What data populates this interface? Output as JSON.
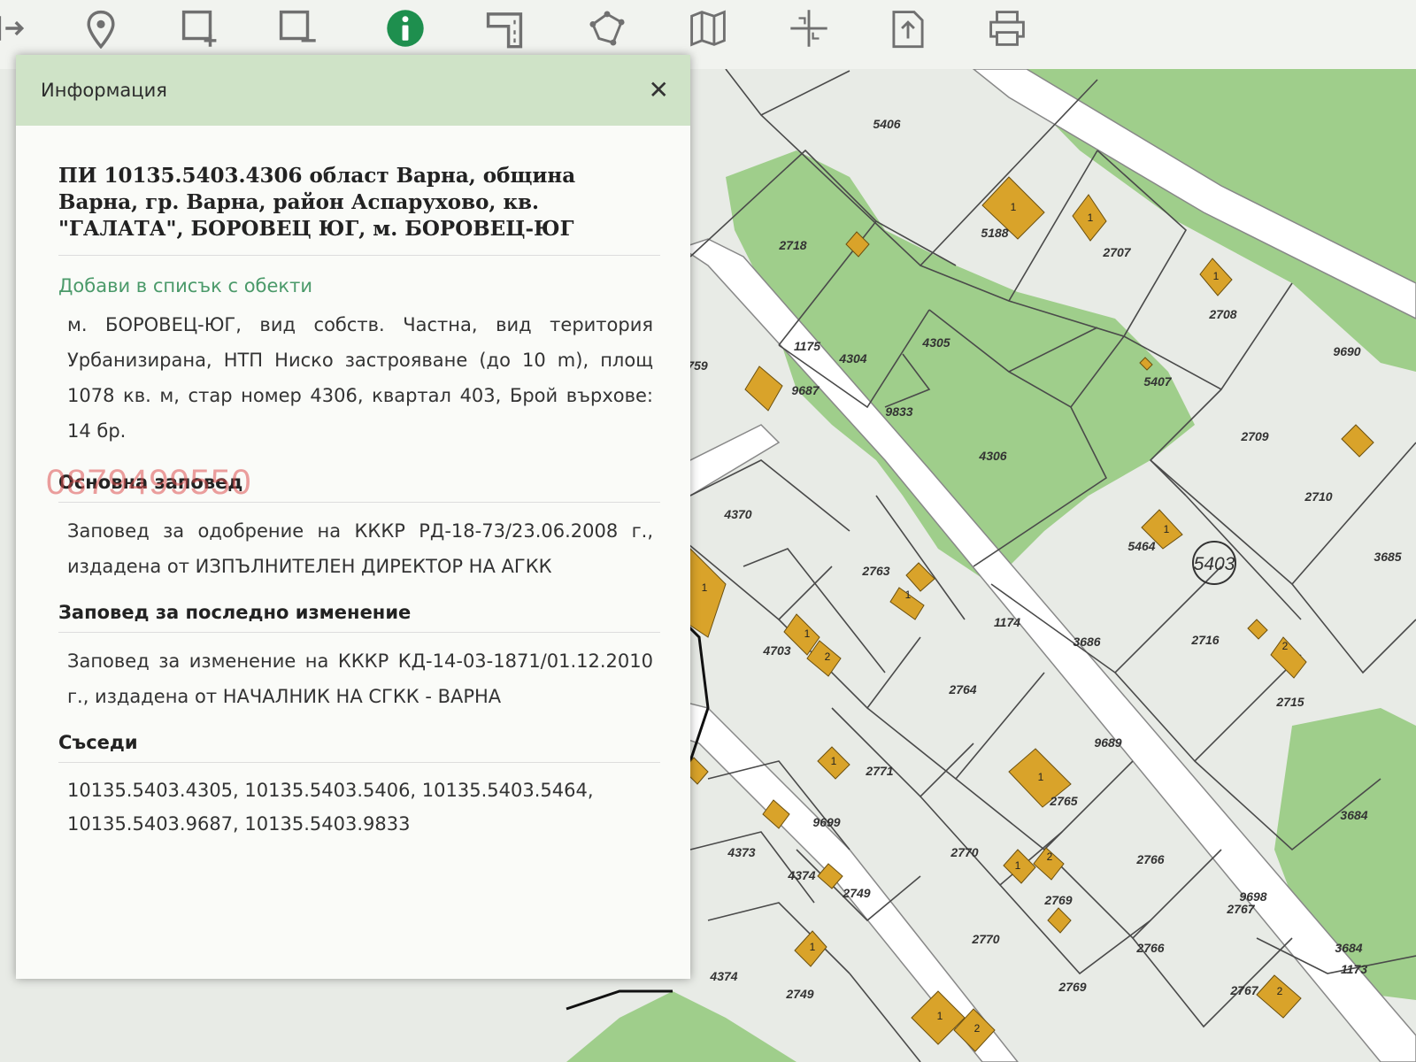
{
  "toolbar": {
    "buttons": [
      {
        "name": "exit",
        "icon": "exit-icon"
      },
      {
        "name": "marker",
        "icon": "map-pin-icon"
      },
      {
        "name": "add-area",
        "icon": "add-rectangle-icon"
      },
      {
        "name": "remove-area",
        "icon": "remove-rectangle-icon"
      },
      {
        "name": "info",
        "icon": "info-icon",
        "active": true
      },
      {
        "name": "measure",
        "icon": "measure-icon"
      },
      {
        "name": "polygon",
        "icon": "polygon-icon"
      },
      {
        "name": "map",
        "icon": "map-icon"
      },
      {
        "name": "coordinates",
        "icon": "crosshair-icon"
      },
      {
        "name": "export",
        "icon": "export-icon"
      },
      {
        "name": "print",
        "icon": "printer-icon"
      }
    ],
    "colors": {
      "info_active": "#1e8f4e",
      "icon": "#707070"
    }
  },
  "panel": {
    "title": "Информация",
    "close_label": "✕",
    "parcel_heading": "ПИ 10135.5403.4306 област Варна, община Варна, гр. Варна, район Аспарухово, кв. \"ГАЛАТА\", БОРОВЕЦ ЮГ, м. БОРОВЕЦ-ЮГ",
    "add_link": "Добави в списък с обекти",
    "description": "м. БОРОВЕЦ-ЮГ, вид собств. Частна, вид територия Урбанизирана, НТП Ниско застрояване (до 10 m), площ 1078 кв. м, стар номер 4306, квартал 403, Брой върхове: 14 бр.",
    "main_order_title": "Основна заповед",
    "watermark": "0879499550",
    "main_order_text": "Заповед за одобрение на КККР РД-18-73/23.06.2008 г., издадена от ИЗПЪЛНИТЕЛЕН ДИРЕКТОР НА АГКК",
    "last_change_title": "Заповед за последно изменение",
    "last_change_text": "Заповед за изменение на КККР КД-14-03-1871/01.12.2010 г., издадена от НАЧАЛНИК НА СГКК - ВАРНА",
    "neighbors_title": "Съседи",
    "neighbors_line1": "10135.5403.4305, 10135.5403.5406, 10135.5403.5464,",
    "neighbors_line2": "10135.5403.9687, 10135.5403.9833",
    "colors": {
      "header": "#cfe3c7",
      "link": "#4b9a6a"
    }
  },
  "map": {
    "parcel_labels": [
      "5406",
      "5188",
      "2707",
      "2718",
      "2708",
      "1175",
      "4304",
      "4305",
      "5407",
      "9690",
      "9687",
      "9833",
      "2709",
      "4306",
      "759",
      "4370",
      "2710",
      "5464",
      "5403",
      "3685",
      "2763",
      "1174",
      "3686",
      "2716",
      "4703",
      "2764",
      "2715",
      "9689",
      "2771",
      "2765",
      "3684",
      "9699",
      "4373",
      "2770",
      "2766",
      "4374",
      "2749",
      "2769",
      "9698",
      "2767",
      "1173",
      "2749",
      "2769",
      "2767",
      "4374",
      "2770",
      "2766",
      "3684"
    ],
    "colors": {
      "background": "#e8ebe6",
      "green": "#9fce8b",
      "building": "#d9a32a",
      "road": "#ffffff",
      "line": "#4a4a4a"
    }
  }
}
